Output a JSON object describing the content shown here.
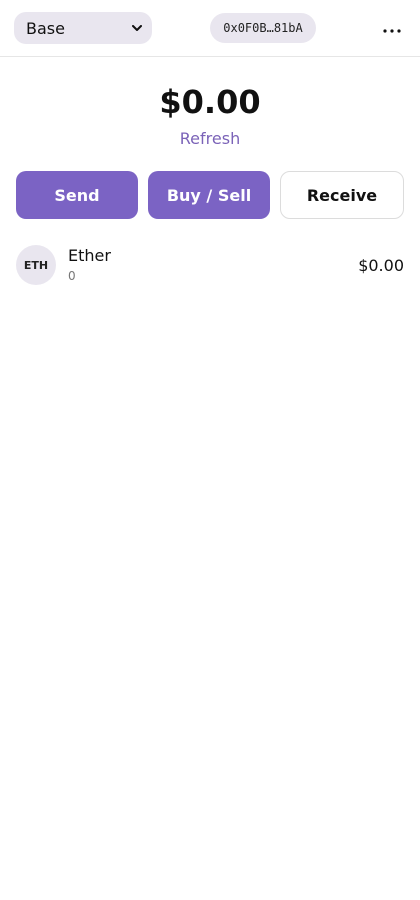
{
  "header": {
    "network": "Base",
    "address": "0x0F0B…81bA"
  },
  "balance": {
    "total": "$0.00",
    "refresh_label": "Refresh"
  },
  "actions": {
    "send": "Send",
    "buy_sell": "Buy / Sell",
    "receive": "Receive"
  },
  "assets": [
    {
      "symbol": "ETH",
      "name": "Ether",
      "amount": "0",
      "value": "$0.00"
    }
  ],
  "colors": {
    "accent": "#7b63c4",
    "link": "#7b63b8",
    "pill_bg": "#e9e6ef"
  },
  "icons": {
    "network_dropdown": "chevron-down-icon",
    "menu": "more-horizontal-icon"
  }
}
